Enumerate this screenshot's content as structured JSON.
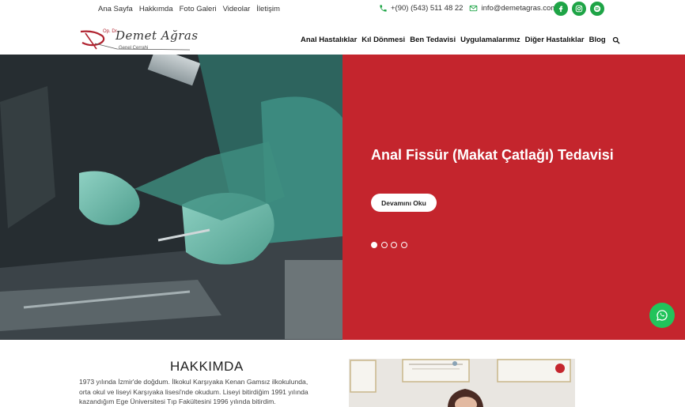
{
  "topnav": [
    "Ana Sayfa",
    "Hakkımda",
    "Foto Galeri",
    "Videolar",
    "İletişim"
  ],
  "contact": {
    "phone": "+(90) (543) 511 48 22",
    "email": "info@demetagras.com"
  },
  "socials": [
    "facebook-icon",
    "instagram-icon",
    "spotify-icon"
  ],
  "logo": {
    "prefix": "Op. Dr.",
    "name": "Demet Ağras",
    "title": "Genel Cerrahi"
  },
  "mainnav": [
    "Anal Hastalıklar",
    "Kıl Dönmesi",
    "Ben Tedavisi",
    "Uygulamalarımız",
    "Diğer Hastalıklar",
    "Blog"
  ],
  "hero": {
    "title": "Anal Fissür (Makat Çatlağı) Tedavisi",
    "button": "Devamını Oku",
    "slides": 4,
    "active_slide": 1
  },
  "about": {
    "heading": "HAKKIMDA",
    "lines": [
      "1973 yılında İzmir'de doğdum. İlkokul Karşıyaka Kenan Gamsız ilkokulunda,",
      "orta okul ve liseyi Karşıyaka lisesi'nde okudum. Liseyi bitirdiğim 1991 yılında",
      "kazandığım Ege Üniversitesi Tıp Fakültesini 1996 yılında bitirdim."
    ]
  },
  "colors": {
    "brand_red": "#c4252d",
    "social_green": "#1ea446",
    "whatsapp_green": "#22c35b"
  }
}
